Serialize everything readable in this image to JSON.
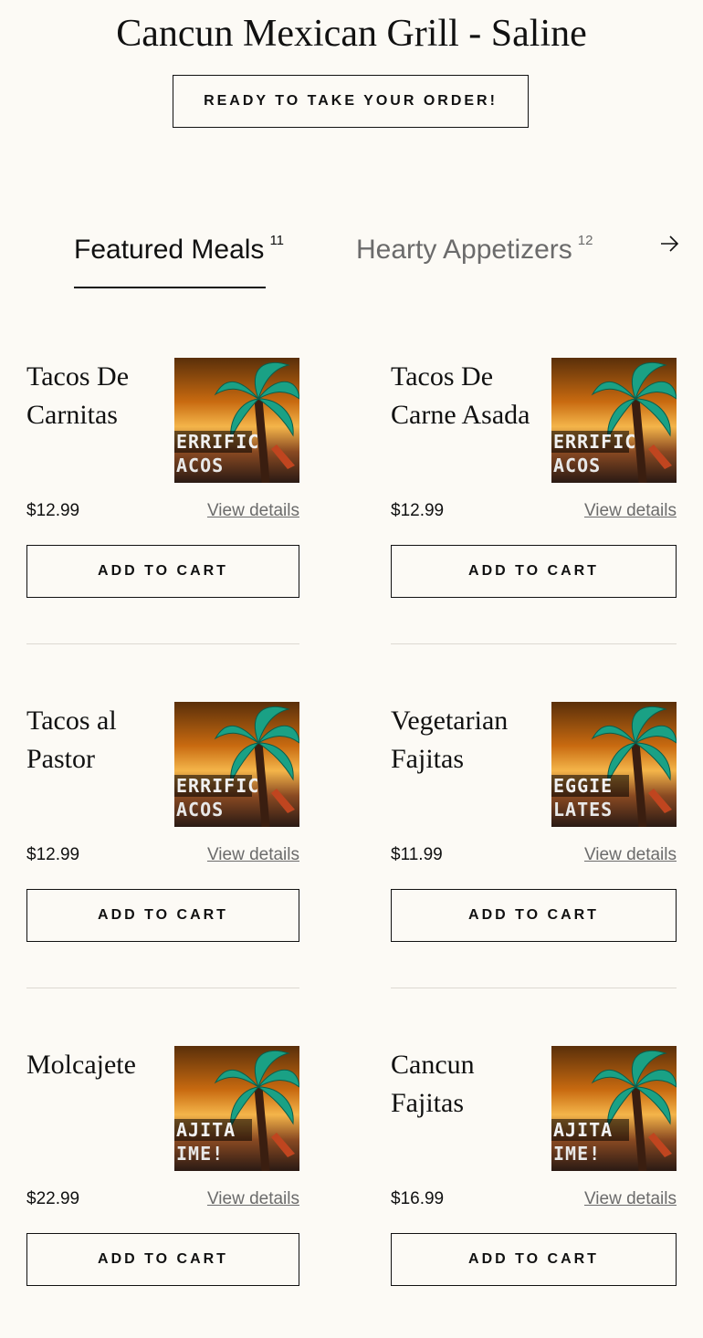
{
  "header": {
    "title": "Cancun Mexican Grill - Saline",
    "cta_label": "READY TO TAKE YOUR ORDER!"
  },
  "tabs": [
    {
      "label": "Featured Meals",
      "count": "11",
      "active": true
    },
    {
      "label": "Hearty Appetizers",
      "count": "12",
      "active": false
    }
  ],
  "next_icon": "arrow-right-icon",
  "items": [
    {
      "name": "Tacos De Carnitas",
      "price": "$12.99",
      "details_label": "View details",
      "add_label": "ADD TO CART",
      "thumb_line1": "ERRIFIC",
      "thumb_line2": "ACOS"
    },
    {
      "name": "Tacos De Carne Asada",
      "price": "$12.99",
      "details_label": "View details",
      "add_label": "ADD TO CART",
      "thumb_line1": "ERRIFIC",
      "thumb_line2": "ACOS"
    },
    {
      "name": "Tacos al Pastor",
      "price": "$12.99",
      "details_label": "View details",
      "add_label": "ADD TO CART",
      "thumb_line1": "ERRIFIC",
      "thumb_line2": "ACOS"
    },
    {
      "name": "Vegetarian Fajitas",
      "price": "$11.99",
      "details_label": "View details",
      "add_label": "ADD TO CART",
      "thumb_line1": "EGGIE",
      "thumb_line2": "LATES"
    },
    {
      "name": "Molcajete",
      "price": "$22.99",
      "details_label": "View details",
      "add_label": "ADD TO CART",
      "thumb_line1": "AJITA",
      "thumb_line2": "IME!"
    },
    {
      "name": "Cancun Fajitas",
      "price": "$16.99",
      "details_label": "View details",
      "add_label": "ADD TO CART",
      "thumb_line1": "AJITA",
      "thumb_line2": "IME!"
    }
  ],
  "colors": {
    "background": "#fcfaf5",
    "text": "#111111",
    "muted": "#6b6b6b",
    "palm": "#1aa185"
  }
}
